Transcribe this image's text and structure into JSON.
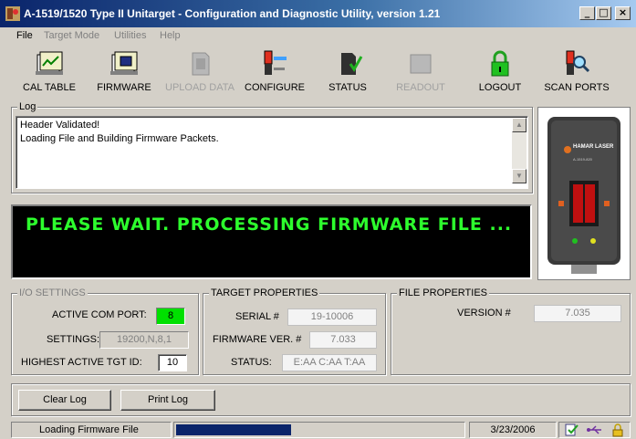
{
  "window": {
    "title": "A-1519/1520 Type II Unitarget - Configuration and Diagnostic Utility, version 1.21",
    "controls": [
      "_",
      "□",
      "×"
    ]
  },
  "menu": [
    {
      "label": "File",
      "enabled": true
    },
    {
      "label": "Target Mode",
      "enabled": false
    },
    {
      "label": "Utilities",
      "enabled": false
    },
    {
      "label": "Help",
      "enabled": false
    }
  ],
  "toolbar": {
    "cal_table": "CAL TABLE",
    "firmware": "FIRMWARE",
    "upload_data": "UPLOAD DATA",
    "configure": "CONFIGURE",
    "status": "STATUS",
    "readout": "READOUT",
    "logout": "LOGOUT",
    "scan_ports": "SCAN PORTS"
  },
  "log": {
    "legend": "Log",
    "lines": [
      "Header Validated!",
      "Loading File and Building Firmware Packets."
    ]
  },
  "banner": {
    "message": "PLEASE WAIT. PROCESSING FIRMWARE FILE ...",
    "color": "#2dff2d"
  },
  "device": {
    "brand": "HAMAR LASER",
    "model": "A-1519-820"
  },
  "io_settings": {
    "legend": "I/O SETTINGS",
    "active_com_port_label": "ACTIVE COM PORT:",
    "active_com_port_value": "8",
    "settings_label": "SETTINGS:",
    "settings_value": "19200,N,8,1",
    "highest_tgt_label": "HIGHEST ACTIVE TGT ID:",
    "highest_tgt_value": "10"
  },
  "target_properties": {
    "legend": "TARGET PROPERTIES",
    "serial_label": "SERIAL #",
    "serial_value": "19-10006",
    "firmware_label": "FIRMWARE VER. #",
    "firmware_value": "7.033",
    "status_label": "STATUS:",
    "status_value": "E:AA C:AA T:AA"
  },
  "file_properties": {
    "legend": "FILE PROPERTIES",
    "version_label": "VERSION #",
    "version_value": "7.035"
  },
  "buttons": {
    "clear_log": "Clear Log",
    "print_log": "Print Log"
  },
  "statusbar": {
    "message": "Loading Firmware File",
    "progress": 0.4,
    "date": "3/23/2006"
  }
}
